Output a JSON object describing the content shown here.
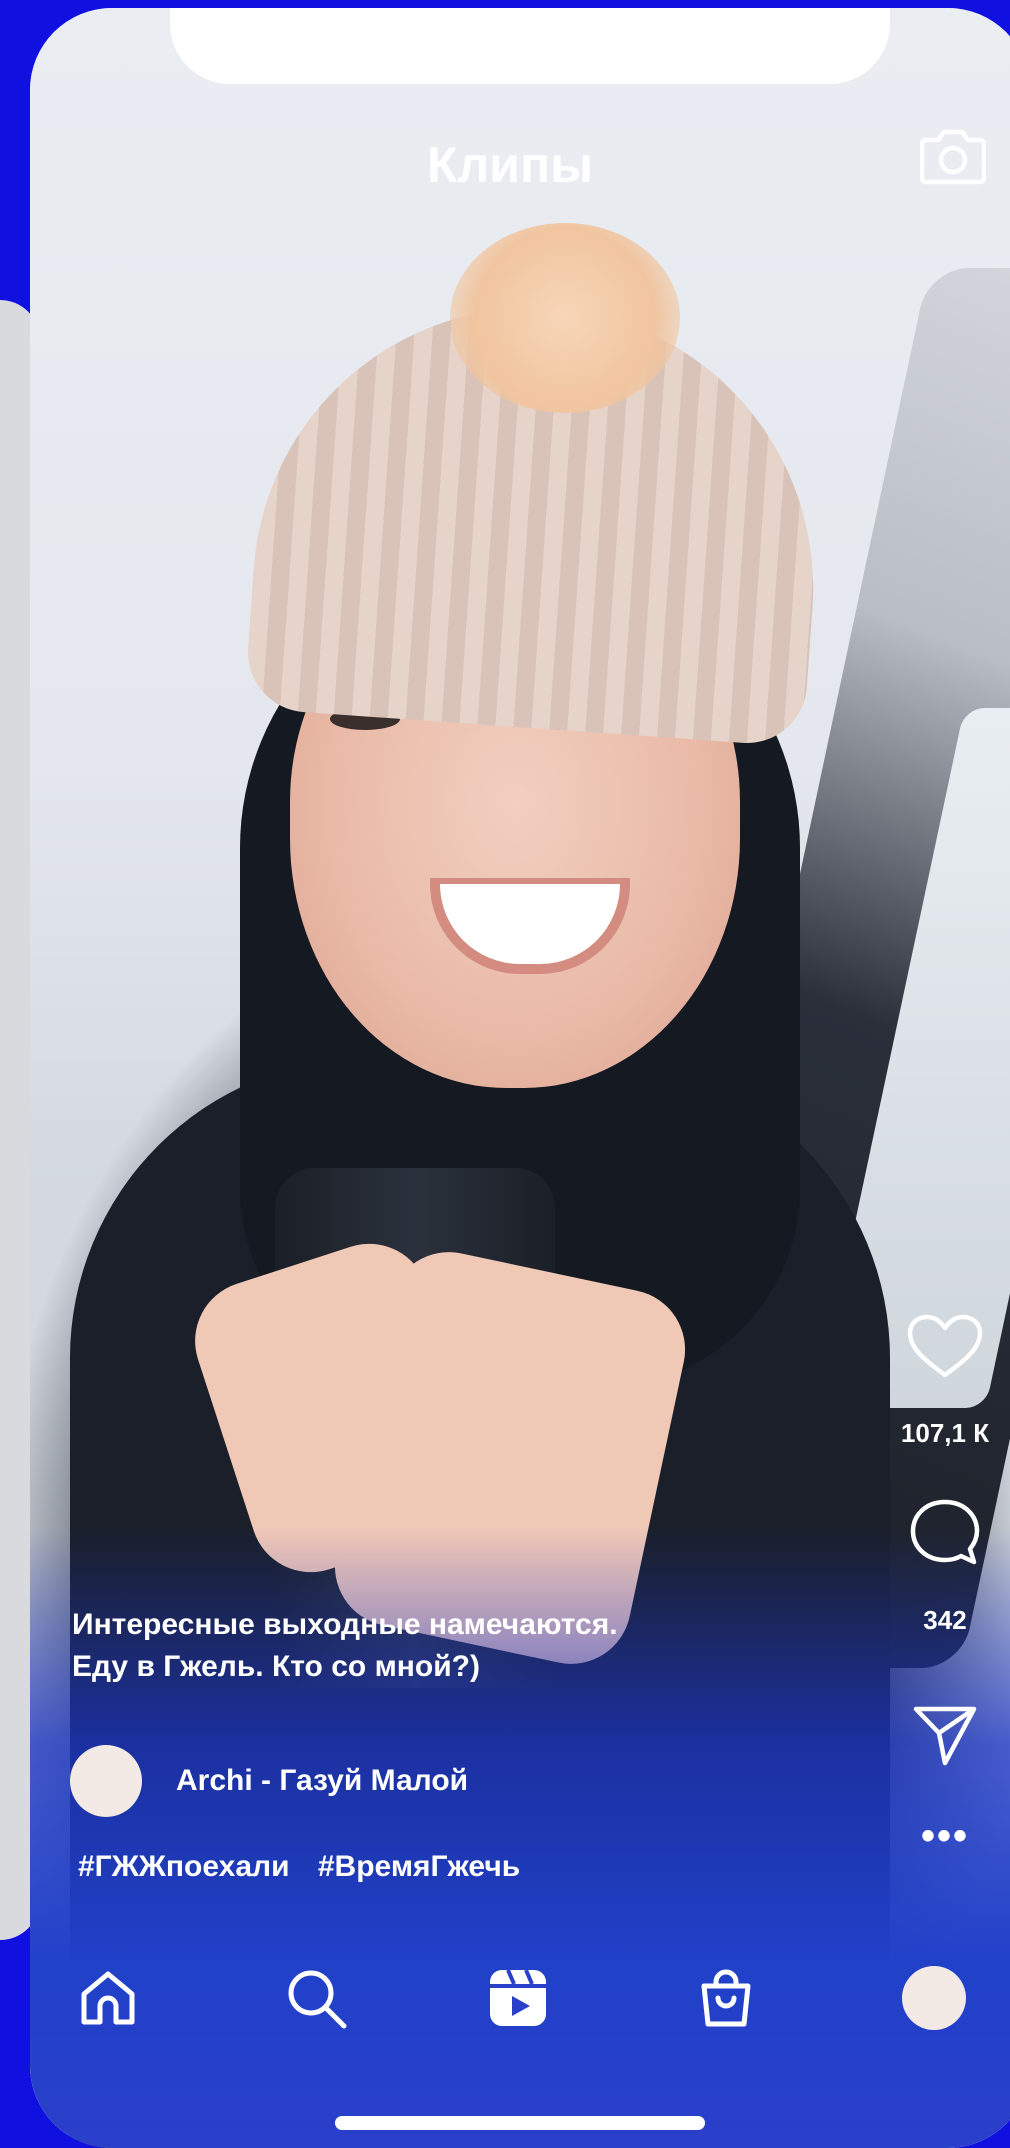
{
  "header": {
    "title": "Клипы",
    "camera_icon": "camera-icon"
  },
  "actions": {
    "like_icon": "heart-icon",
    "like_count": "107,1 К",
    "comment_icon": "comment-icon",
    "comment_count": "342",
    "share_icon": "send-icon",
    "more_icon": "more-dots-icon",
    "more_label": "•••"
  },
  "post": {
    "caption_line1": "Интересные выходные намечаются.",
    "caption_line2": "Еду в Гжель. Кто со мной?)",
    "author_name": "Archi - Газуй Малой",
    "hashtags": [
      "#ГЖЖпоехали",
      "#ВремяГжечь"
    ]
  },
  "nav": {
    "items": [
      {
        "name": "home",
        "icon": "home-icon"
      },
      {
        "name": "search",
        "icon": "search-icon"
      },
      {
        "name": "clips",
        "icon": "clips-icon"
      },
      {
        "name": "shop",
        "icon": "shopping-bag-icon"
      },
      {
        "name": "profile",
        "icon": "profile-avatar"
      }
    ]
  },
  "colors": {
    "background_brand": "#1010e0",
    "bottom_gradient": "#2a3fca",
    "text": "#ffffff"
  }
}
